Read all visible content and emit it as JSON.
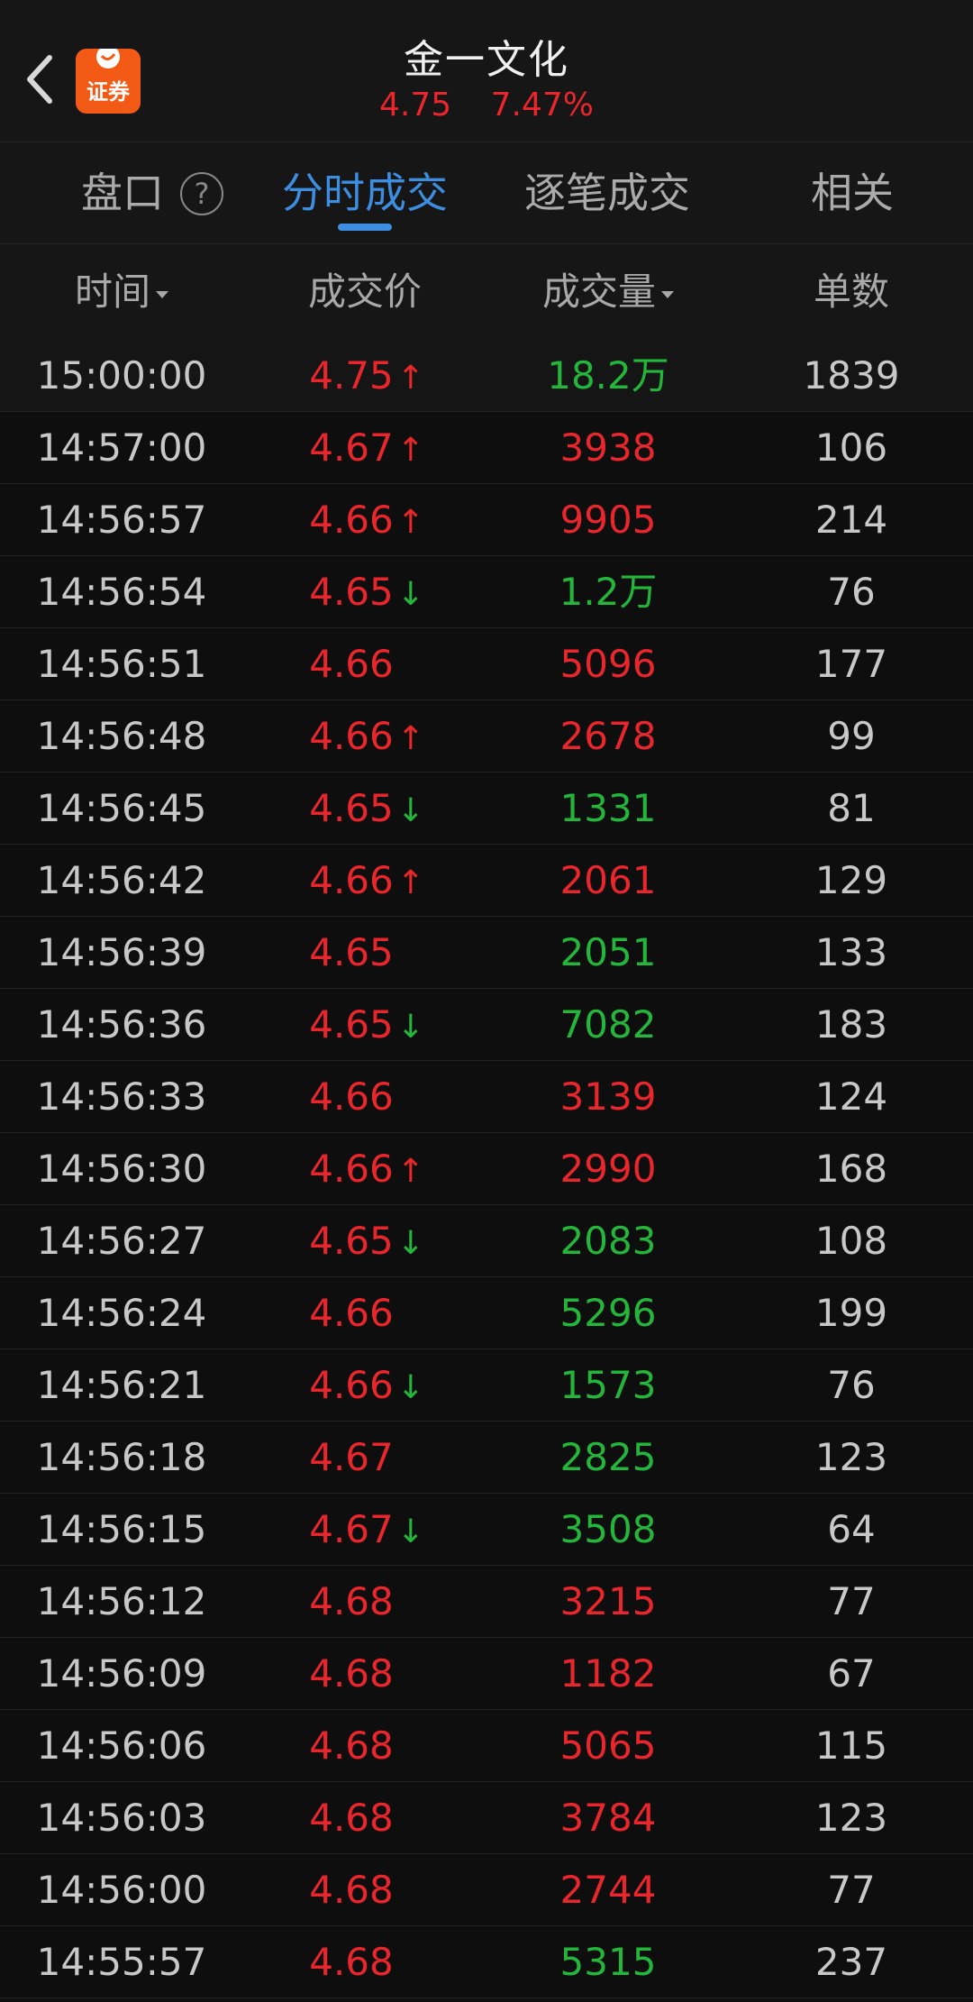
{
  "header": {
    "title": "金一文化",
    "price": "4.75",
    "change_pct": "7.47%",
    "logo_text": "证券"
  },
  "tabs": [
    {
      "label": "盘口",
      "active": false
    },
    {
      "label": "分时成交",
      "active": true
    },
    {
      "label": "逐笔成交",
      "active": false
    },
    {
      "label": "相关",
      "active": false
    }
  ],
  "columns": {
    "time": "时间",
    "price": "成交价",
    "volume": "成交量",
    "count": "单数"
  },
  "colors": {
    "up": "#e8262b",
    "down": "#24b53b",
    "accent": "#3d8ee0"
  },
  "rows": [
    {
      "time": "15:00:00",
      "price": "4.75",
      "arrow": "up",
      "volume": "18.2万",
      "vol_color": "down",
      "count": "1839"
    },
    {
      "time": "14:57:00",
      "price": "4.67",
      "arrow": "up",
      "volume": "3938",
      "vol_color": "up",
      "count": "106"
    },
    {
      "time": "14:56:57",
      "price": "4.66",
      "arrow": "up",
      "volume": "9905",
      "vol_color": "up",
      "count": "214"
    },
    {
      "time": "14:56:54",
      "price": "4.65",
      "arrow": "down",
      "volume": "1.2万",
      "vol_color": "down",
      "count": "76"
    },
    {
      "time": "14:56:51",
      "price": "4.66",
      "arrow": "",
      "volume": "5096",
      "vol_color": "up",
      "count": "177"
    },
    {
      "time": "14:56:48",
      "price": "4.66",
      "arrow": "up",
      "volume": "2678",
      "vol_color": "up",
      "count": "99"
    },
    {
      "time": "14:56:45",
      "price": "4.65",
      "arrow": "down",
      "volume": "1331",
      "vol_color": "down",
      "count": "81"
    },
    {
      "time": "14:56:42",
      "price": "4.66",
      "arrow": "up",
      "volume": "2061",
      "vol_color": "up",
      "count": "129"
    },
    {
      "time": "14:56:39",
      "price": "4.65",
      "arrow": "",
      "volume": "2051",
      "vol_color": "down",
      "count": "133"
    },
    {
      "time": "14:56:36",
      "price": "4.65",
      "arrow": "down",
      "volume": "7082",
      "vol_color": "down",
      "count": "183"
    },
    {
      "time": "14:56:33",
      "price": "4.66",
      "arrow": "",
      "volume": "3139",
      "vol_color": "up",
      "count": "124"
    },
    {
      "time": "14:56:30",
      "price": "4.66",
      "arrow": "up",
      "volume": "2990",
      "vol_color": "up",
      "count": "168"
    },
    {
      "time": "14:56:27",
      "price": "4.65",
      "arrow": "down",
      "volume": "2083",
      "vol_color": "down",
      "count": "108"
    },
    {
      "time": "14:56:24",
      "price": "4.66",
      "arrow": "",
      "volume": "5296",
      "vol_color": "down",
      "count": "199"
    },
    {
      "time": "14:56:21",
      "price": "4.66",
      "arrow": "down",
      "volume": "1573",
      "vol_color": "down",
      "count": "76"
    },
    {
      "time": "14:56:18",
      "price": "4.67",
      "arrow": "",
      "volume": "2825",
      "vol_color": "down",
      "count": "123"
    },
    {
      "time": "14:56:15",
      "price": "4.67",
      "arrow": "down",
      "volume": "3508",
      "vol_color": "down",
      "count": "64"
    },
    {
      "time": "14:56:12",
      "price": "4.68",
      "arrow": "",
      "volume": "3215",
      "vol_color": "up",
      "count": "77"
    },
    {
      "time": "14:56:09",
      "price": "4.68",
      "arrow": "",
      "volume": "1182",
      "vol_color": "up",
      "count": "67"
    },
    {
      "time": "14:56:06",
      "price": "4.68",
      "arrow": "",
      "volume": "5065",
      "vol_color": "up",
      "count": "115"
    },
    {
      "time": "14:56:03",
      "price": "4.68",
      "arrow": "",
      "volume": "3784",
      "vol_color": "up",
      "count": "123"
    },
    {
      "time": "14:56:00",
      "price": "4.68",
      "arrow": "",
      "volume": "2744",
      "vol_color": "up",
      "count": "77"
    },
    {
      "time": "14:55:57",
      "price": "4.68",
      "arrow": "",
      "volume": "5315",
      "vol_color": "down",
      "count": "237"
    }
  ]
}
